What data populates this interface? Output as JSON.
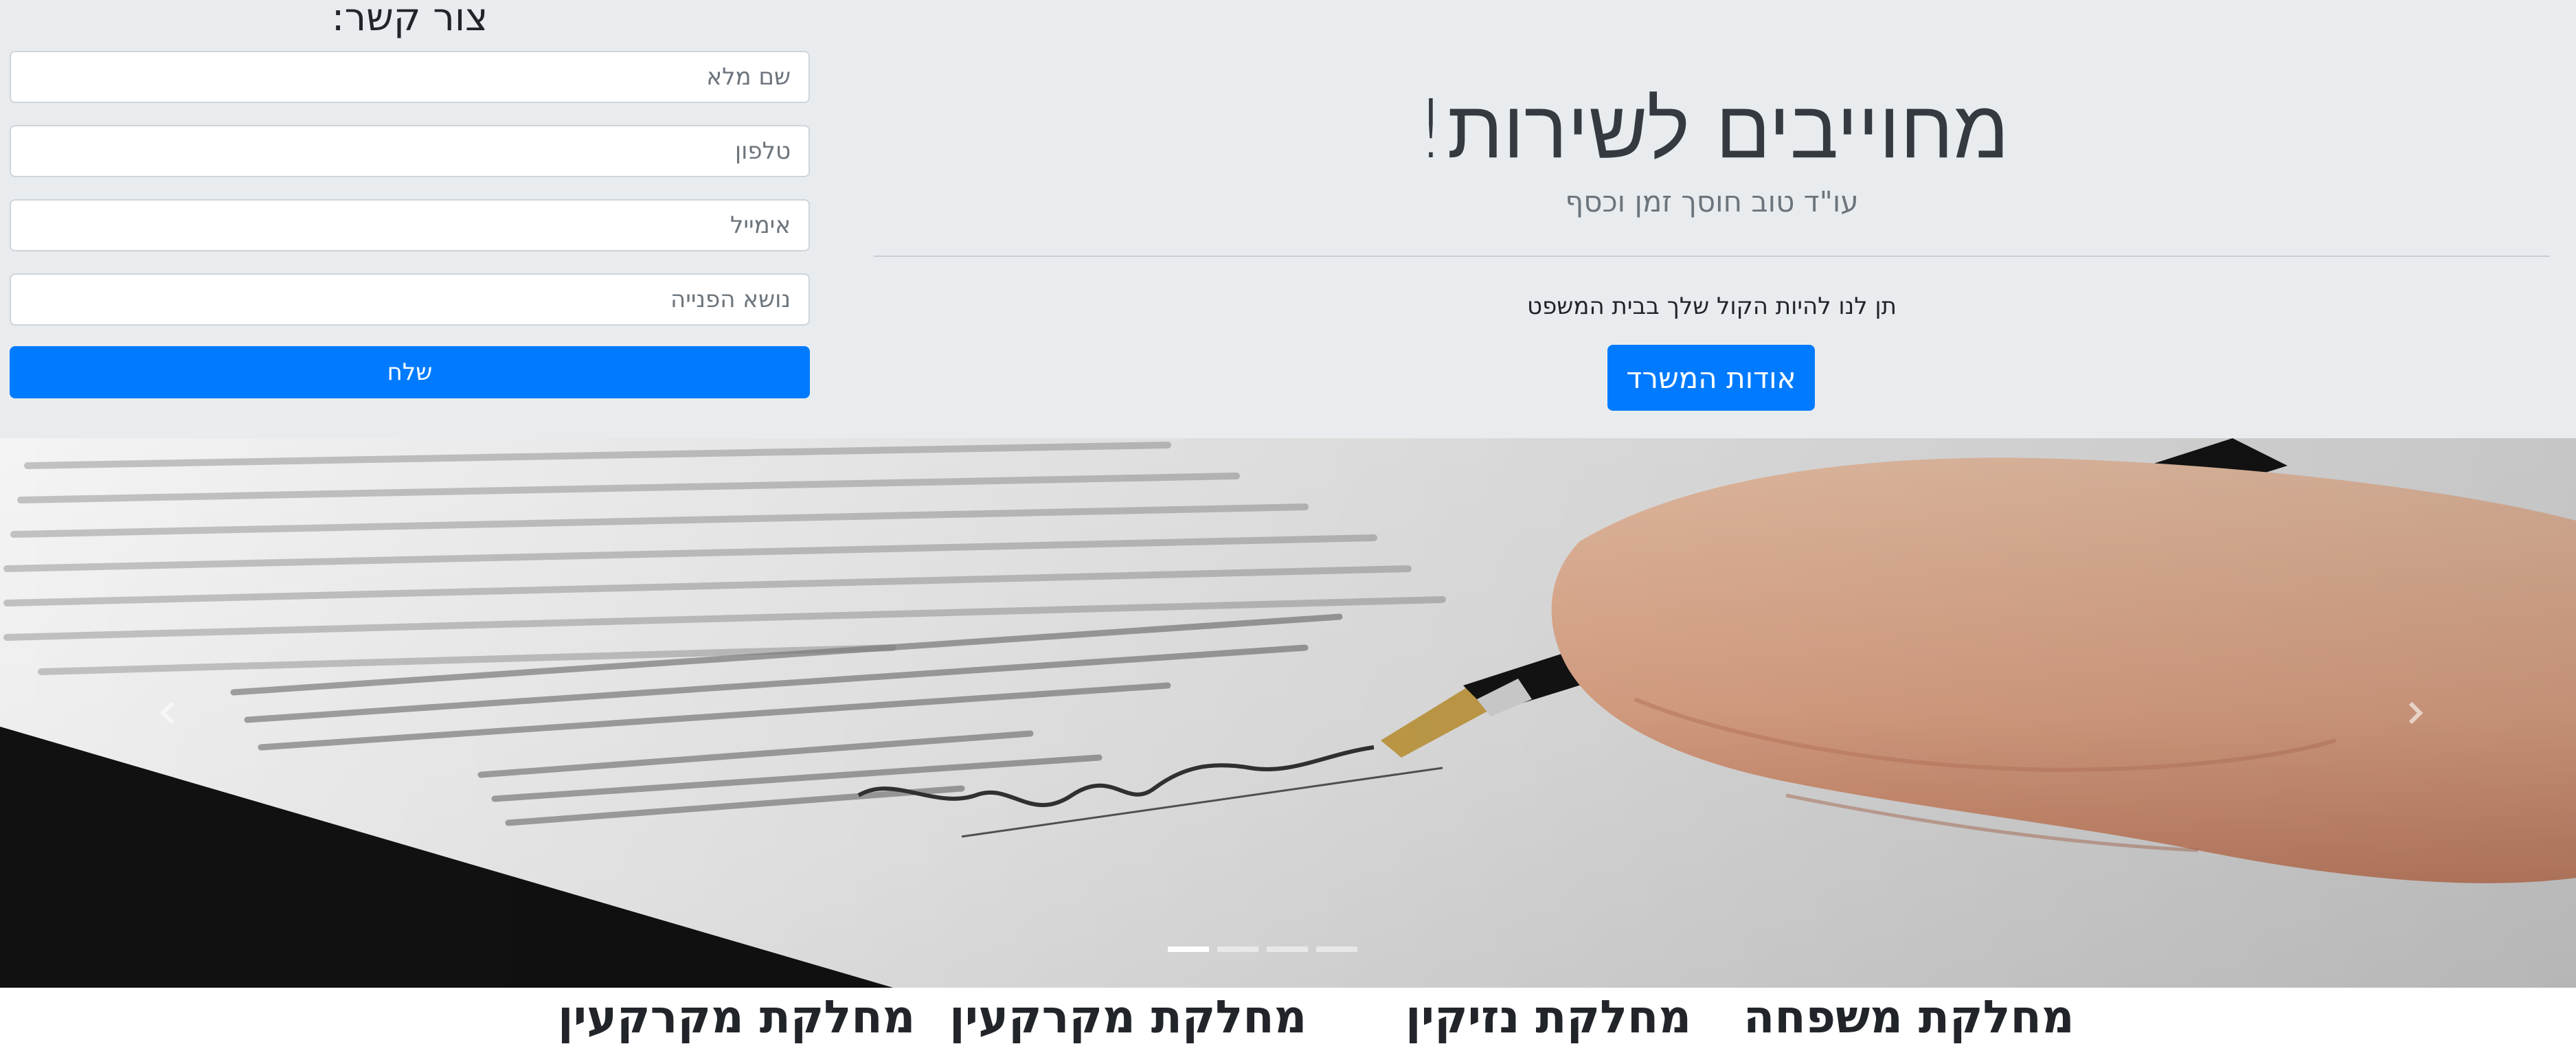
{
  "contact": {
    "title": "צור קשר:",
    "fields": [
      {
        "placeholder": "שם מלא"
      },
      {
        "placeholder": "טלפון"
      },
      {
        "placeholder": "אימייל"
      },
      {
        "placeholder": "נושא הפנייה"
      }
    ],
    "submit_label": "שלח"
  },
  "jumbotron": {
    "title": "מחוייבים לשירות!",
    "lead": "עו\"ד טוב חוסך זמן וכסף",
    "text": "תן לנו להיות הקול שלך בבית המשפט",
    "button_label": "אודות המשרד"
  },
  "carousel": {
    "prev_icon": "chevron-left-icon",
    "next_icon": "chevron-right-icon",
    "slide_count": 4,
    "active_index": 3
  },
  "departments": [
    "מחלקת משפחה",
    "מחלקת נזיקין",
    "מחלקת מקרקעין",
    "מחלקת מקרקעין"
  ],
  "colors": {
    "primary": "#007bff",
    "band": "#e9ecef"
  }
}
